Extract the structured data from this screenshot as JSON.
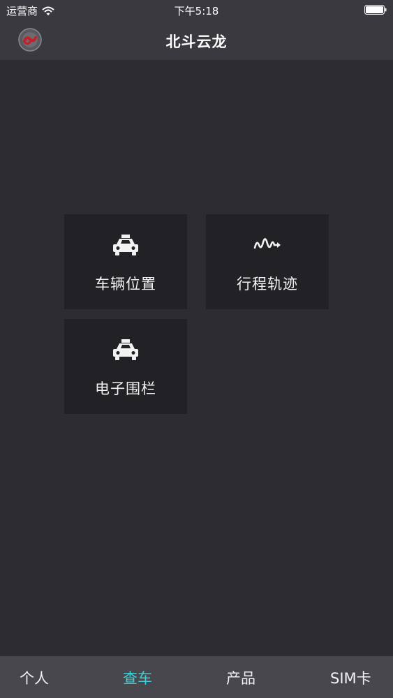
{
  "status_bar": {
    "carrier": "运营商",
    "time": "下午5:18"
  },
  "nav_bar": {
    "title": "北斗云龙"
  },
  "menu": {
    "items": [
      {
        "label": "车辆位置",
        "icon": "car-icon"
      },
      {
        "label": "行程轨迹",
        "icon": "route-icon"
      },
      {
        "label": "电子围栏",
        "icon": "car-icon"
      }
    ]
  },
  "tab_bar": {
    "items": [
      {
        "label": "个人"
      },
      {
        "label": "查车",
        "active": true
      },
      {
        "label": "产品"
      },
      {
        "label": "SIM卡"
      }
    ],
    "active_color": "#3fd0d8"
  },
  "colors": {
    "background": "#2d2c32",
    "bar": "#3a393f",
    "tile": "#222126",
    "tab_bar": "#48474d"
  }
}
